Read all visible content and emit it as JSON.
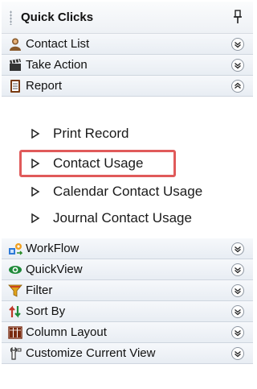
{
  "panel": {
    "title": "Quick Clicks",
    "pin_icon": "pin-icon",
    "sections_top": [
      {
        "label": "Contact List",
        "icon": "contact-person-icon",
        "toggle": "expand-chevron-icon"
      },
      {
        "label": "Take Action",
        "icon": "clapperboard-icon",
        "toggle": "expand-chevron-icon"
      },
      {
        "label": "Report",
        "icon": "report-document-icon",
        "toggle": "collapse-chevron-icon"
      }
    ],
    "report_items": [
      {
        "label": "Print Record"
      },
      {
        "label": "Contact Usage",
        "highlighted": true,
        "highlight_color": "#e05a5a"
      },
      {
        "label": "Calendar Contact Usage"
      },
      {
        "label": "Journal Contact Usage"
      }
    ],
    "sections_bottom": [
      {
        "label": "WorkFlow",
        "icon": "workflow-icon",
        "toggle": "expand-chevron-icon"
      },
      {
        "label": "QuickView",
        "icon": "eye-icon",
        "toggle": "expand-chevron-icon"
      },
      {
        "label": "Filter",
        "icon": "funnel-icon",
        "toggle": "expand-chevron-icon"
      },
      {
        "label": "Sort By",
        "icon": "sort-arrows-icon",
        "toggle": "expand-chevron-icon"
      },
      {
        "label": "Column Layout",
        "icon": "columns-icon",
        "toggle": "expand-chevron-icon"
      },
      {
        "label": "Customize Current View",
        "icon": "wrench-icon",
        "toggle": "expand-chevron-icon"
      }
    ]
  }
}
